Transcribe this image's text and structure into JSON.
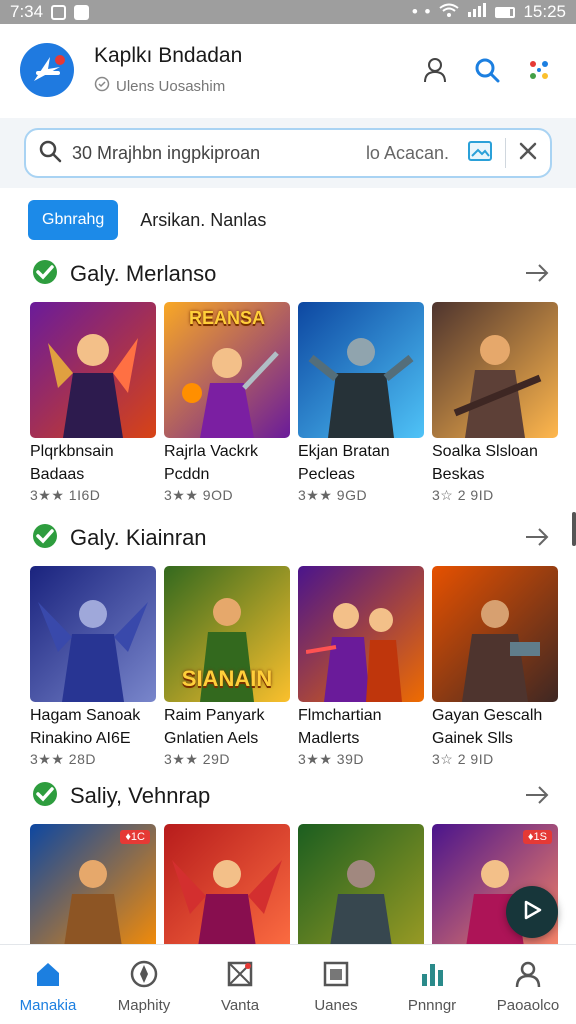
{
  "status_bar": {
    "time_left": "7:34",
    "time_right": "15:25"
  },
  "header": {
    "title": "Kaplkı Bndadan",
    "subtitle": "Ulens Uosashim",
    "icons": [
      "user-icon",
      "search-icon",
      "apps-icon"
    ]
  },
  "search": {
    "value": "30 Mrajhbn ingpkiproan",
    "language": "lo Acacan."
  },
  "filters": {
    "active": "Gbnrahg",
    "other": "Arsikan. Nanlas"
  },
  "sections": [
    {
      "title": "Galy. Merlanso",
      "items": [
        {
          "name1": "Plqrkbnsain",
          "name2": "Badaas",
          "meta": "3★★ 1I6D",
          "c1": "#6a1b9a",
          "c2": "#d84315"
        },
        {
          "name1": "Rajrla Vackrk",
          "name2": "Pcddn",
          "meta": "3★★ 9OD",
          "c1": "#f9a825",
          "c2": "#6a1b9a",
          "banner": "REANSA"
        },
        {
          "name1": "Ekjan Bratan",
          "name2": "Pecleas",
          "meta": "3★★ 9GD",
          "c1": "#0d47a1",
          "c2": "#4fc3f7"
        },
        {
          "name1": "Soalka Slsloan",
          "name2": "Beskas",
          "meta": "3☆ 2 9ID",
          "c1": "#4e342e",
          "c2": "#ffb74d"
        }
      ]
    },
    {
      "title": "Galy. Kiainran",
      "items": [
        {
          "name1": "Hagam Sanoak",
          "name2": "Rinakino AI6E",
          "meta": "3★★ 28D",
          "c1": "#1a237e",
          "c2": "#7986cb"
        },
        {
          "name1": "Raim Panyark",
          "name2": "Gnlatien Aels",
          "meta": "3★★ 29D",
          "c1": "#33691e",
          "c2": "#fbc02d",
          "banner": "SIANAIN"
        },
        {
          "name1": "Flmchartian",
          "name2": "Madlerts",
          "meta": "3★★ 39D",
          "c1": "#4a148c",
          "c2": "#ef6c00"
        },
        {
          "name1": "Gayan Gescalh",
          "name2": "Gainek Slls",
          "meta": "3☆ 2 9ID",
          "c1": "#e65100",
          "c2": "#3e2723"
        }
      ]
    },
    {
      "title": "Saliy, Vehnrap",
      "items": [
        {
          "name1": "",
          "name2": "",
          "meta": "",
          "c1": "#0d47a1",
          "c2": "#ff8f00",
          "tag": "♦1C"
        },
        {
          "name1": "",
          "name2": "",
          "meta": "",
          "c1": "#b71c1c",
          "c2": "#ff7043"
        },
        {
          "name1": "",
          "name2": "",
          "meta": "",
          "c1": "#1b5e20",
          "c2": "#9e9d24"
        },
        {
          "name1": "",
          "name2": "",
          "meta": "",
          "c1": "#4a148c",
          "c2": "#ff8a65",
          "tag": "♦1S"
        }
      ]
    }
  ],
  "bottom_nav": [
    {
      "label": "Manakia",
      "icon": "home-icon",
      "active": true
    },
    {
      "label": "Maphity",
      "icon": "compass-icon",
      "active": false
    },
    {
      "label": "Vanta",
      "icon": "image-icon",
      "active": false
    },
    {
      "label": "Uanes",
      "icon": "window-icon",
      "active": false
    },
    {
      "label": "Pnnngr",
      "icon": "chart-icon",
      "active": false
    },
    {
      "label": "Paoaolco",
      "icon": "profile-icon",
      "active": false
    }
  ],
  "colors": {
    "accent": "#1c8ae8",
    "check": "#2e9d3e"
  }
}
